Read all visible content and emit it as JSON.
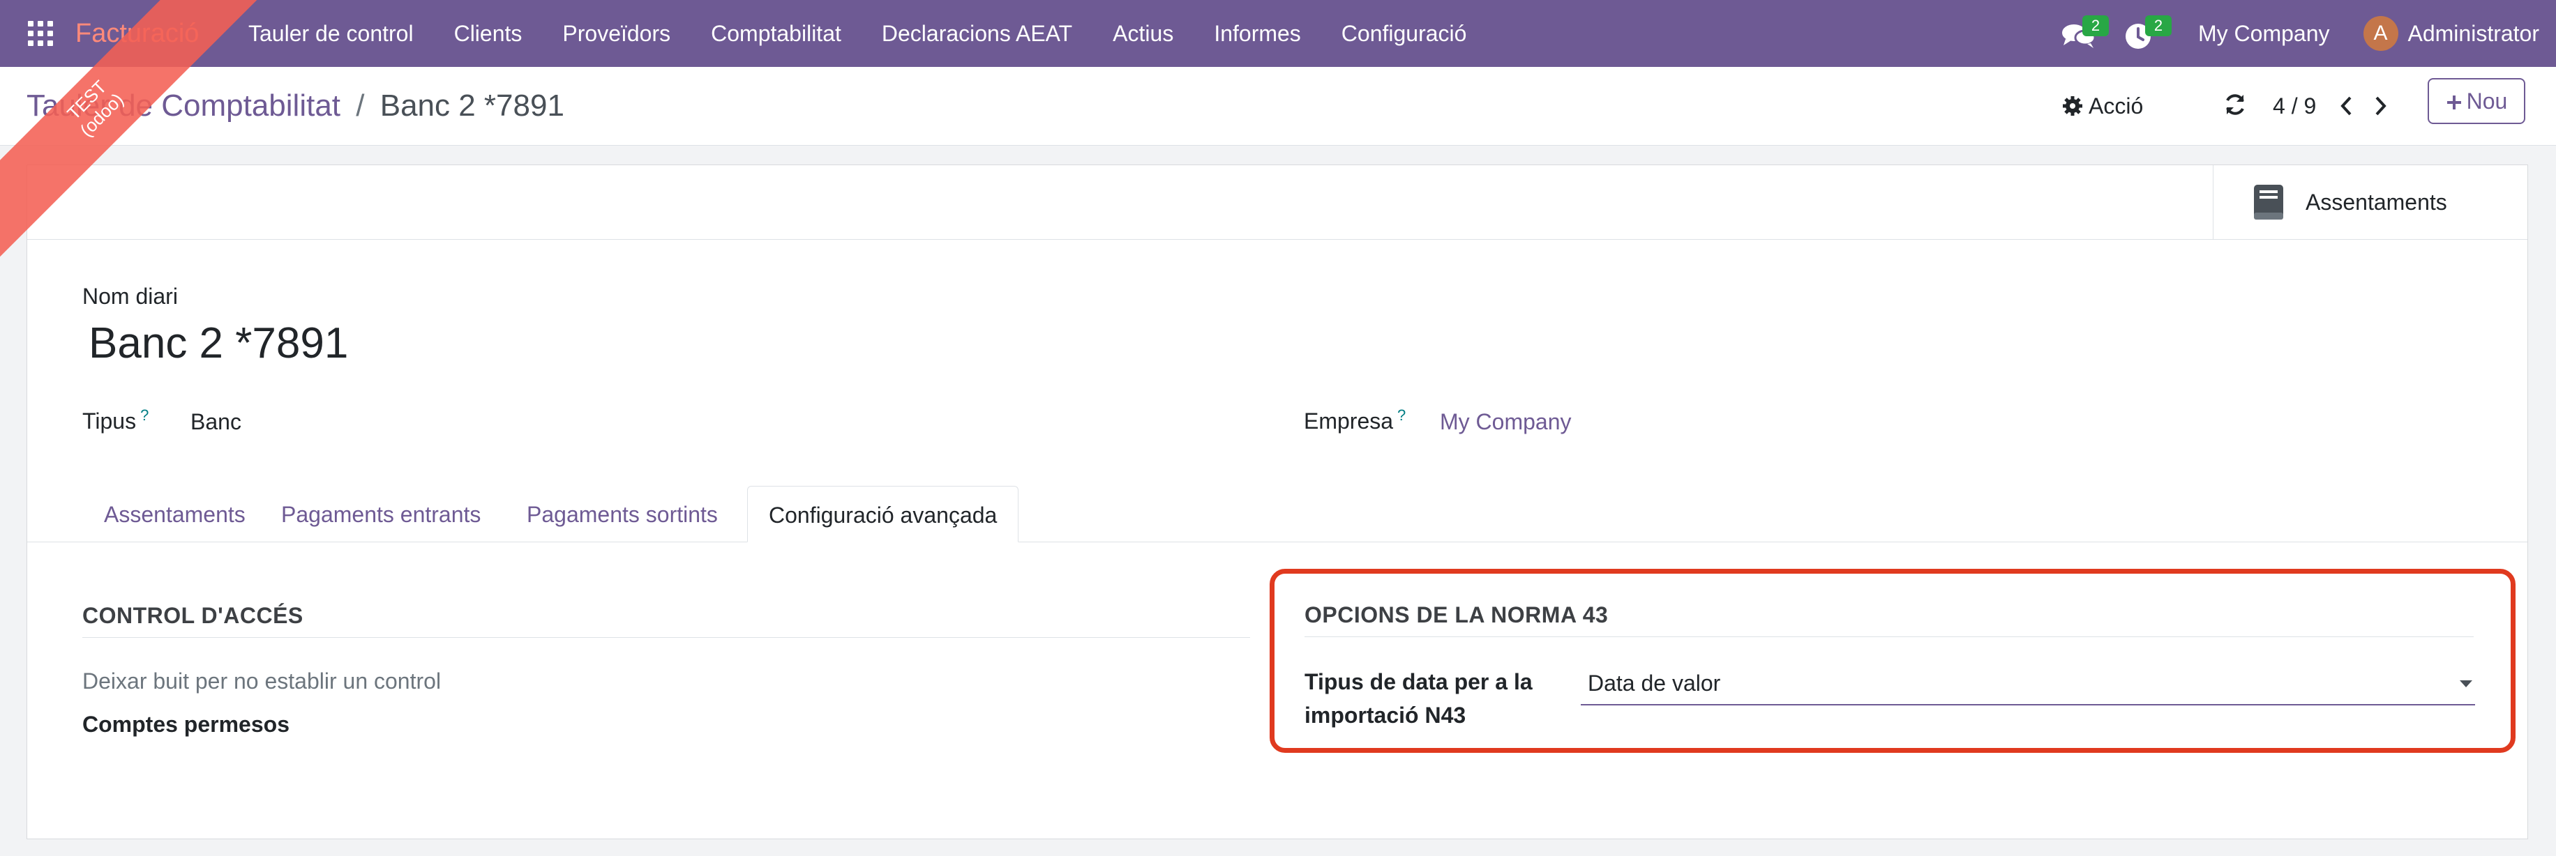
{
  "navbar": {
    "brand": "Facturació",
    "menu": [
      "Tauler de control",
      "Clients",
      "Proveïdors",
      "Comptabilitat",
      "Declaracions AEAT",
      "Actius",
      "Informes",
      "Configuració"
    ],
    "messages_badge": "2",
    "activities_badge": "2",
    "company": "My Company",
    "avatar_letter": "A",
    "user": "Administrator"
  },
  "ribbon": {
    "line1": "TEST",
    "line2": "(odoo)"
  },
  "breadcrumb": {
    "parent": "Tauler de Comptabilitat",
    "separator": "/",
    "current": "Banc 2 *7891"
  },
  "control": {
    "action_label": "Acció",
    "pager": "4 / 9",
    "new_label": "Nou"
  },
  "stat_button": {
    "label": "Assentaments"
  },
  "form": {
    "journal_name_label": "Nom diari",
    "journal_name": "Banc 2 *7891",
    "type_label": "Tipus",
    "type_help": "?",
    "type_value": "Banc",
    "company_label": "Empresa",
    "company_help": "?",
    "company_value": "My Company"
  },
  "tabs": [
    "Assentaments",
    "Pagaments entrants",
    "Pagaments sortints",
    "Configuració avançada"
  ],
  "access_control": {
    "title": "CONTROL D'ACCÉS",
    "hint": "Deixar buit per no establir un control",
    "allowed_accounts_label": "Comptes permesos"
  },
  "norma43": {
    "title": "OPCIONS DE LA NORMA 43",
    "date_type_label_line1": "Tipus de data per a la",
    "date_type_label_line2": "importació N43",
    "date_type_value": "Data de valor"
  },
  "colors": {
    "primary": "#6e5a94",
    "highlight": "#e03a1f",
    "badge": "#28a745"
  }
}
